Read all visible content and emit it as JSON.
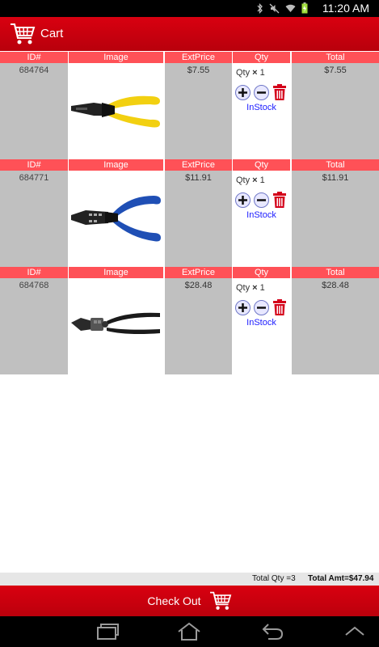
{
  "status_bar": {
    "time": "11:20 AM"
  },
  "app_bar": {
    "title": "Cart",
    "icon": "cart-icon"
  },
  "columns": {
    "id": "ID#",
    "image": "Image",
    "ext_price": "ExtPrice",
    "qty": "Qty",
    "total": "Total"
  },
  "items": [
    {
      "id": "684764",
      "ext_price": "$7.55",
      "qty_label": "Qty",
      "qty_x": "×",
      "qty": "1",
      "stock": "InStock",
      "total": "$7.55",
      "image": "yellow-wire-stripper",
      "handle_color": "#f2d011"
    },
    {
      "id": "684771",
      "ext_price": "$11.91",
      "qty_label": "Qty",
      "qty_x": "×",
      "qty": "1",
      "stock": "InStock",
      "total": "$11.91",
      "image": "blue-wire-stripper",
      "handle_color": "#1f4fb5"
    },
    {
      "id": "684768",
      "ext_price": "$28.48",
      "qty_label": "Qty",
      "qty_x": "×",
      "qty": "1",
      "stock": "InStock",
      "total": "$28.48",
      "image": "black-crimper",
      "handle_color": "#1a1a1a"
    }
  ],
  "totals": {
    "total_qty": "Total Qty =3",
    "total_amt": "Total Amt=$47.94"
  },
  "checkout": {
    "label": "Check Out"
  },
  "colors": {
    "brand_red": "#cc0010",
    "header_red": "#ff5157",
    "cell_gray": "#c0c0c0",
    "link_blue": "#1a1aff"
  }
}
